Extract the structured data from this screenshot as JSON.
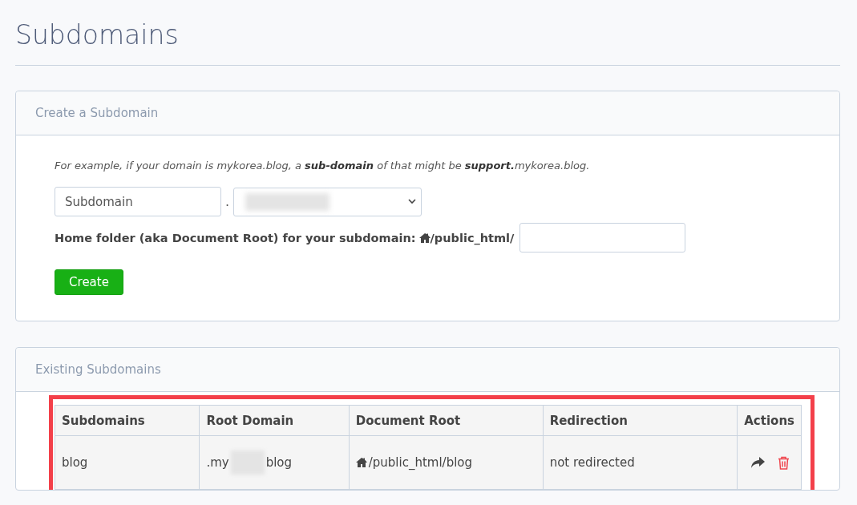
{
  "page_title": "Subdomains",
  "create_panel": {
    "title": "Create a Subdomain",
    "example": "For example, if your domain is mykorea.blog, a **sub-domain** of that might be **support.**mykorea.blog.",
    "subdomain_field": {
      "placeholder": "Subdomain"
    },
    "separator": ".",
    "home_folder_label": "Home folder (aka Document Root) for your subdomain:",
    "home_folder_prefix": "/public_html/",
    "create_button": "Create"
  },
  "existing_panel": {
    "title": "Existing Subdomains",
    "table": {
      "columns": [
        "Subdomains",
        "Root Domain",
        "Document Root",
        "Redirection",
        "Actions"
      ],
      "rows": [
        {
          "subdomain": "blog",
          "root_domain_start": ".my",
          "root_domain_end": "blog",
          "document_root": "/public_html/blog",
          "redirection": "not redirected"
        }
      ]
    }
  }
}
